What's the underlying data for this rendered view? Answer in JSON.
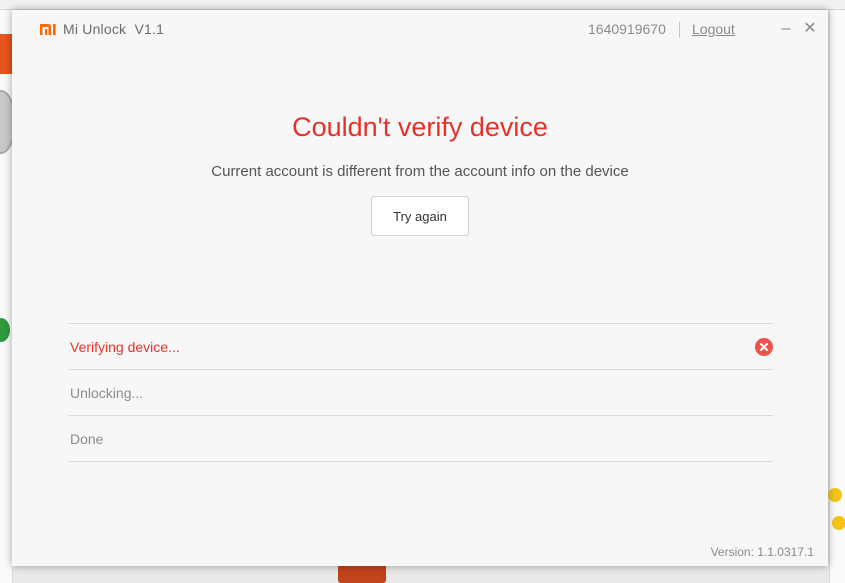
{
  "window": {
    "title": "Mi Unlock",
    "version_badge": "V1.1",
    "account_id": "1640919670",
    "logout_label": "Logout",
    "minimize_glyph": "–",
    "close_glyph": "✕"
  },
  "status": {
    "headline": "Couldn't verify device",
    "message": "Current account is different from the account info on the device",
    "retry_label": "Try again"
  },
  "steps": [
    {
      "label": "Verifying device...",
      "state": "error"
    },
    {
      "label": "Unlocking...",
      "state": "pending"
    },
    {
      "label": "Done",
      "state": "pending"
    }
  ],
  "footer": {
    "version": "Version: 1.1.0317.1"
  },
  "colors": {
    "accent_red": "#e4322b",
    "brand_orange": "#ff6700",
    "error_icon": "#ef5350"
  }
}
